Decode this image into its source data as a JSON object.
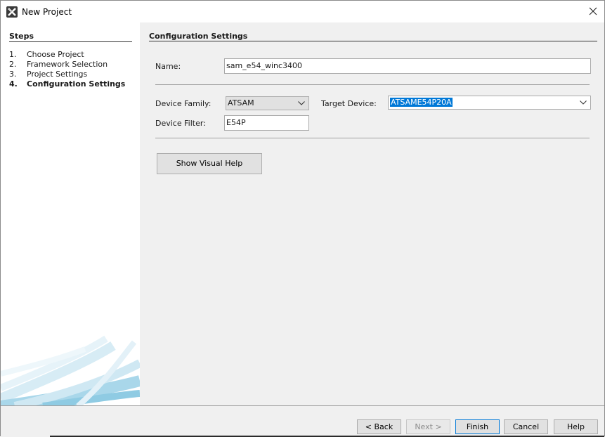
{
  "window": {
    "title": "New Project",
    "icons": {
      "app": "harmony-x-logo-icon",
      "close": "close-icon"
    }
  },
  "steps": {
    "heading": "Steps",
    "items": [
      {
        "num": "1.",
        "label": "Choose Project",
        "active": false
      },
      {
        "num": "2.",
        "label": "Framework Selection",
        "active": false
      },
      {
        "num": "3.",
        "label": "Project Settings",
        "active": false
      },
      {
        "num": "4.",
        "label": "Configuration Settings",
        "active": true
      }
    ]
  },
  "config": {
    "heading": "Configuration Settings",
    "name_label": "Name:",
    "name_value": "sam_e54_winc3400",
    "device_family_label": "Device Family:",
    "device_family_value": "ATSAM",
    "target_device_label": "Target Device:",
    "target_device_value": "ATSAME54P20A",
    "device_filter_label": "Device Filter:",
    "device_filter_value": "E54P",
    "visual_help_label": "Show Visual Help"
  },
  "footer": {
    "back_label": "< Back",
    "next_label": "Next >",
    "finish_label": "Finish",
    "cancel_label": "Cancel",
    "help_label": "Help"
  },
  "colors": {
    "selection": "#0078d7",
    "panel_bg": "#f0f0f0",
    "swirl": "#8fcbe3"
  }
}
